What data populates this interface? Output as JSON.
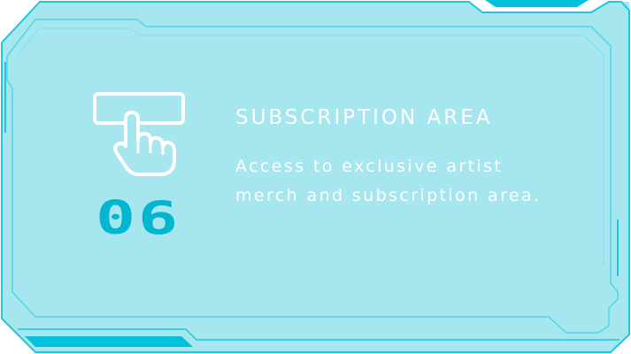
{
  "card": {
    "number": "06",
    "title": "SUBSCRIPTION AREA",
    "description": "Access to exclusive artist merch and subscription area.",
    "icon": "hand-pointer-click-icon"
  },
  "colors": {
    "panel_fill": "#a5e6ef",
    "frame_stroke": "#1ec6e0",
    "accent": "#00c2dc",
    "number": "#00b6d0",
    "text": "#ffffff"
  }
}
